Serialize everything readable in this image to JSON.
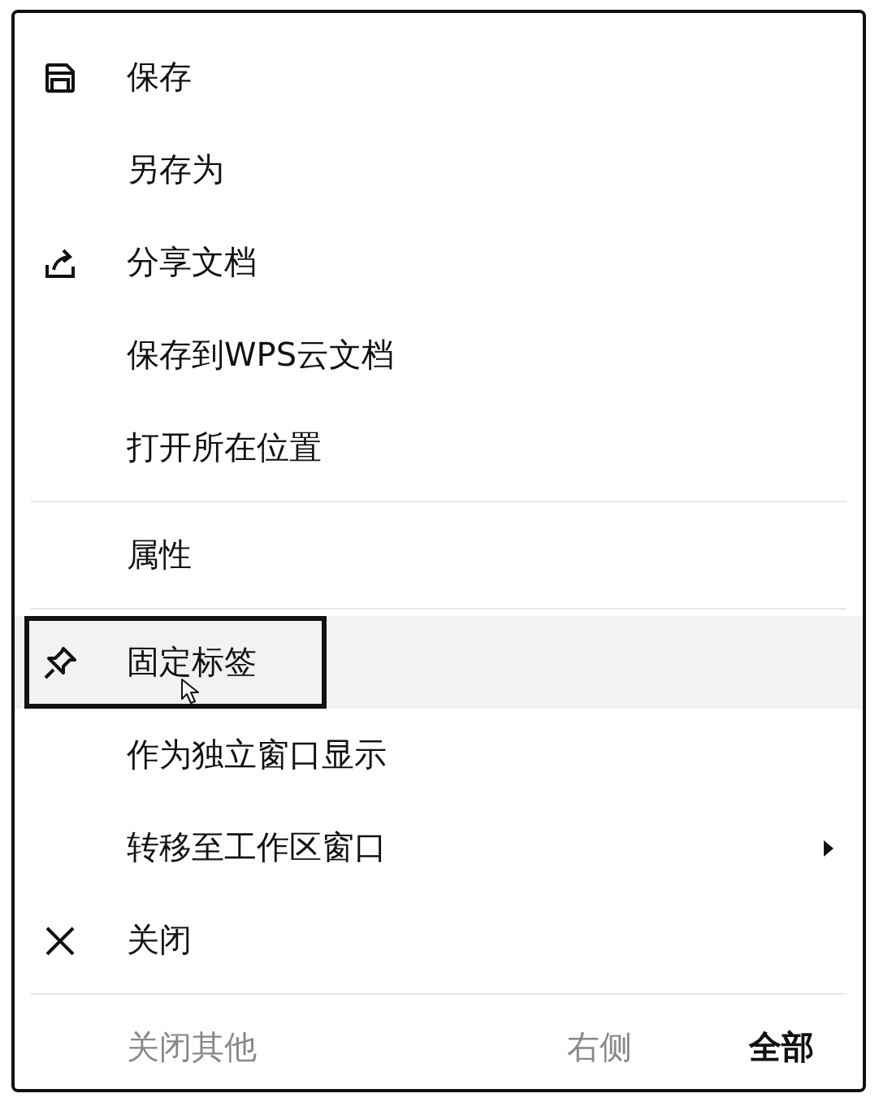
{
  "menu": {
    "items": [
      {
        "kind": "save",
        "label": "保存",
        "selected": false
      },
      {
        "kind": "plain",
        "label": "另存为",
        "selected": false
      },
      {
        "kind": "share",
        "label": "分享文档",
        "selected": false
      },
      {
        "kind": "plain",
        "label": "保存到WPS云文档",
        "selected": false
      },
      {
        "kind": "plain",
        "label": "打开所在位置",
        "selected": false
      },
      {
        "kind": "separator"
      },
      {
        "kind": "plain",
        "label": "属性",
        "selected": false
      },
      {
        "kind": "separator"
      },
      {
        "kind": "pin",
        "label": "固定标签",
        "selected": true
      },
      {
        "kind": "plain",
        "label": "作为独立窗口显示",
        "selected": false
      },
      {
        "kind": "submenu",
        "label": "转移至工作区窗口",
        "selected": false
      },
      {
        "kind": "close",
        "label": "关闭",
        "selected": false
      },
      {
        "kind": "separator"
      }
    ],
    "bottom_actions": [
      {
        "label": "关闭其他",
        "disabled": true
      },
      {
        "label": "右侧",
        "disabled": true
      },
      {
        "label": "全部",
        "disabled": false
      }
    ]
  }
}
